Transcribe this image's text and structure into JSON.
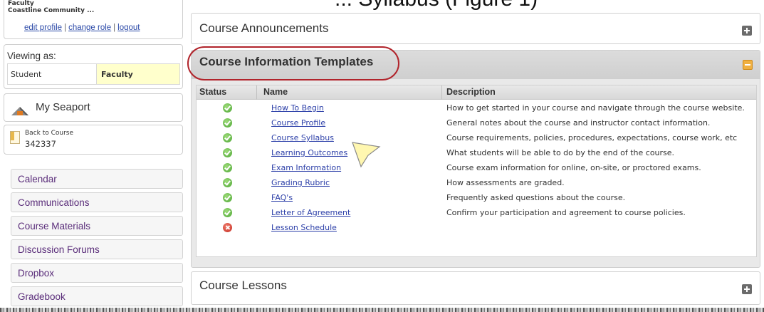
{
  "page_title": "... Syllabus (Figure 1)",
  "user": {
    "role": "Faculty",
    "institution": "Coastline Community ...",
    "links": [
      "edit profile",
      "change role",
      "logout"
    ],
    "separator": "|"
  },
  "viewing": {
    "label": "Viewing as:",
    "options": [
      "Student",
      "Faculty"
    ],
    "selected": "Faculty"
  },
  "my_seaport": {
    "label": "My Seaport",
    "icon": "home-icon"
  },
  "back_to_course": {
    "label": "Back to Course",
    "course_number": "342337",
    "icon": "document-icon"
  },
  "nav": {
    "items": [
      "Calendar",
      "Communications",
      "Course Materials",
      "Discussion Forums",
      "Dropbox",
      "Gradebook"
    ]
  },
  "panels": {
    "announcements": {
      "title": "Course Announcements",
      "icon": "expand-plus-icon"
    },
    "templates": {
      "title": "Course Information Templates",
      "icon": "collapse-minus-icon"
    },
    "lessons": {
      "title": "Course Lessons",
      "icon": "expand-plus-icon"
    }
  },
  "templates_table": {
    "columns": [
      "Status",
      "Name",
      "Description"
    ],
    "rows": [
      {
        "status": "complete",
        "name": "How To Begin",
        "description": "How to get started in your course and navigate through the course website."
      },
      {
        "status": "complete",
        "name": "Course Profile",
        "description": "General notes about the course and instructor contact information."
      },
      {
        "status": "complete",
        "name": "Course Syllabus",
        "description": "Course requirements, policies, procedures, expectations, course work, etc"
      },
      {
        "status": "complete",
        "name": "Learning Outcomes",
        "description": "What students will be able to do by the end of the course."
      },
      {
        "status": "complete",
        "name": "Exam Information",
        "description": "Course exam information for online, on-site, or proctored exams."
      },
      {
        "status": "complete",
        "name": "Grading Rubric",
        "description": "How assessments are graded."
      },
      {
        "status": "complete",
        "name": "FAQ's",
        "description": "Frequently asked questions about the course."
      },
      {
        "status": "complete",
        "name": "Letter of Agreement",
        "description": "Confirm your participation and agreement to course policies."
      },
      {
        "status": "incomplete",
        "name": "Lesson Schedule",
        "description": ""
      }
    ]
  },
  "colors": {
    "nav_text": "#5a2d7a",
    "link": "#2c3fa8",
    "highlight_ring": "#b1242b",
    "selected_role_bg": "#ffffcc",
    "status_complete": "#4aa532",
    "status_incomplete": "#c4281e"
  }
}
